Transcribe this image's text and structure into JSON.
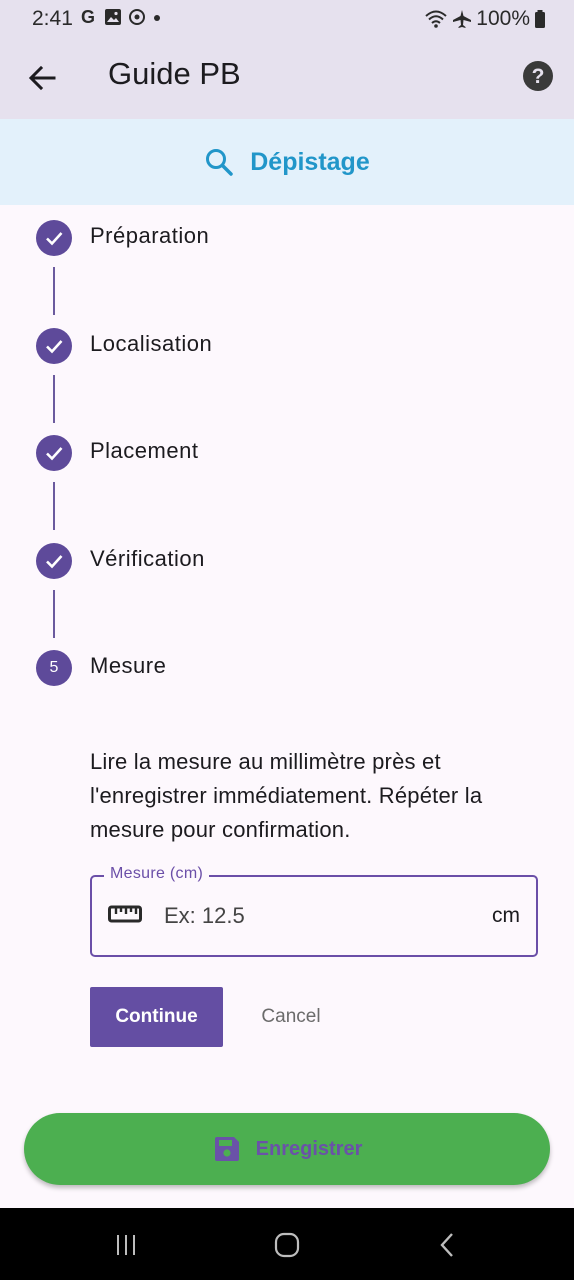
{
  "status_bar": {
    "time": "2:41",
    "battery": "100%",
    "left_icons": [
      "google-icon",
      "gallery-icon",
      "sync-icon",
      "dot-icon"
    ],
    "right_icons": [
      "wifi-icon",
      "airplane-icon",
      "battery-icon"
    ]
  },
  "app_bar": {
    "title": "Guide PB",
    "back_icon": "arrow-back-icon",
    "help_icon": "help-icon"
  },
  "section": {
    "title": "Dépistage",
    "icon": "search-icon",
    "color": "#2196c9"
  },
  "steps": [
    {
      "label": "Préparation",
      "state": "done"
    },
    {
      "label": "Localisation",
      "state": "done"
    },
    {
      "label": "Placement",
      "state": "done"
    },
    {
      "label": "Vérification",
      "state": "done"
    },
    {
      "label": "Mesure",
      "state": "active",
      "number": "5"
    }
  ],
  "current_step": {
    "instructions": "Lire la mesure au millimètre près et l'enregistrer immédiatement. Répéter la mesure pour confirmation.",
    "field": {
      "label": "Mesure (cm)",
      "placeholder": "Ex: 12.5",
      "value": "",
      "suffix": "cm",
      "icon": "ruler-icon"
    },
    "continue_label": "Continue",
    "cancel_label": "Cancel"
  },
  "save_button": {
    "label": "Enregistrer",
    "icon": "save-icon",
    "color": "#4caf50"
  },
  "colors": {
    "accent": "#644ea3",
    "background": "#fdf8fd",
    "app_bar": "#e6e1ee"
  }
}
